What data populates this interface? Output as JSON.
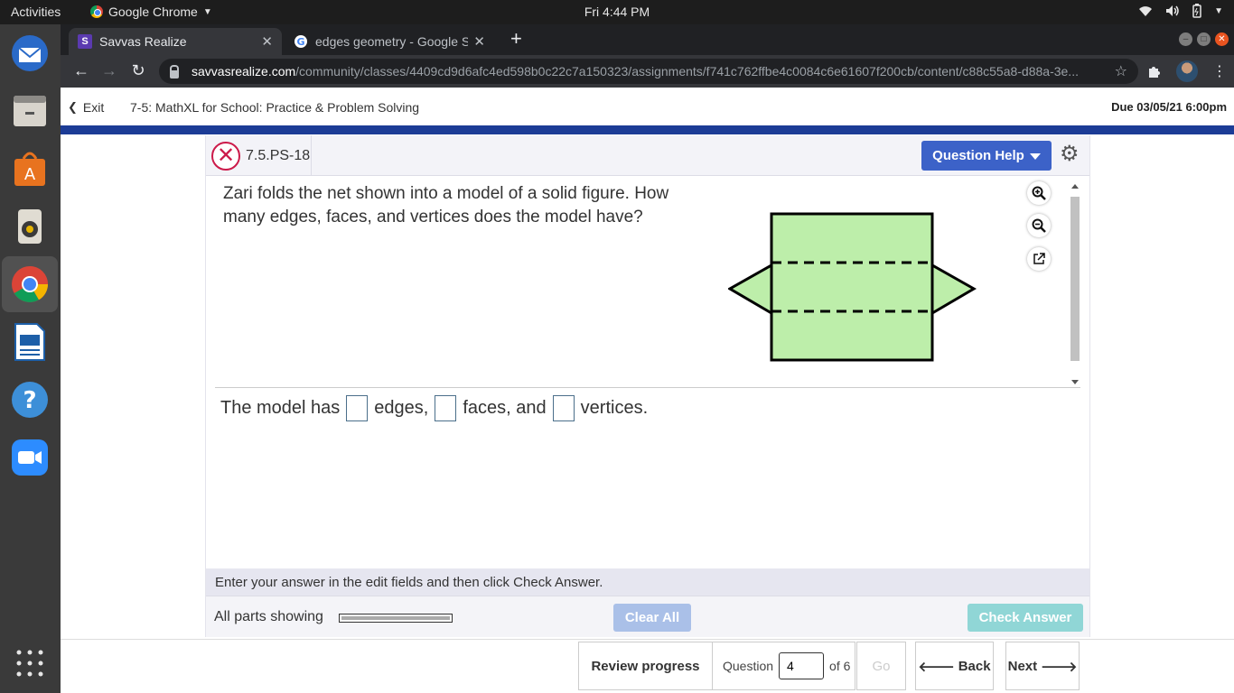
{
  "topbar": {
    "activities": "Activities",
    "app_name": "Google Chrome",
    "clock": "Fri  4:44 PM"
  },
  "dock": {
    "items": [
      "thunderbird-icon",
      "files-icon",
      "software-center-icon",
      "rhythmbox-icon",
      "chrome-icon",
      "writer-icon",
      "help-icon",
      "zoom-icon",
      "app-grid-icon"
    ]
  },
  "browser": {
    "tabs": [
      {
        "title": "Savvas Realize",
        "active": true
      },
      {
        "title": "edges geometry - Google S",
        "active": false
      }
    ],
    "url_domain": "savvasrealize.com",
    "url_path": "/community/classes/4409cd9d6afc4ed598b0c22c7a150323/assignments/f741c762ffbe4c0084c6e61607f200cb/content/c88c55a8-d88a-3e..."
  },
  "header": {
    "exit_label": "Exit",
    "assignment_title": "7-5: MathXL for School: Practice & Problem Solving",
    "due": "Due 03/05/21 6:00pm"
  },
  "question": {
    "id": "7.5.PS-18",
    "help_label": "Question Help",
    "text": "Zari folds the net shown into a model of a solid figure. How many edges, faces, and vertices does the model have?",
    "answer_prefix": "The model has",
    "answer_edges": "edges,",
    "answer_faces": "faces, and",
    "answer_vertices": "vertices.",
    "instructions": "Enter your answer in the edit fields and then click Check Answer.",
    "all_parts": "All parts showing",
    "clear_all": "Clear All",
    "check_answer": "Check Answer"
  },
  "footer": {
    "review_progress": "Review progress",
    "question_label": "Question",
    "question_number": "4",
    "of_total": "of 6",
    "go": "Go",
    "back": "Back",
    "next": "Next"
  },
  "colors": {
    "net_fill": "#bdeeaa",
    "help_button": "#3c62c8",
    "header_bar": "#1c3c96",
    "incorrect": "#cc1a4a"
  }
}
